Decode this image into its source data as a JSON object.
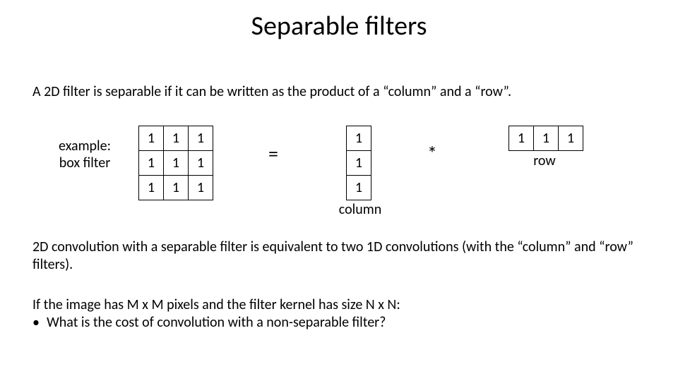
{
  "title": "Separable filters",
  "intro": "A 2D filter is separable if it can be written as the product of a “column” and a “row”.",
  "example_label_line1": "example:",
  "example_label_line2": "box filter",
  "box": {
    "r0c0": "1",
    "r0c1": "1",
    "r0c2": "1",
    "r1c0": "1",
    "r1c1": "1",
    "r1c2": "1",
    "r2c0": "1",
    "r2c1": "1",
    "r2c2": "1"
  },
  "equals": "=",
  "column_vec": {
    "c0": "1",
    "c1": "1",
    "c2": "1"
  },
  "star": "*",
  "row_vec": {
    "r0": "1",
    "r1": "1",
    "r2": "1"
  },
  "row_label": "row",
  "column_label": "column",
  "para2": "2D convolution with a separable filter is equivalent to two 1D convolutions (with the “column” and “row” filters).",
  "para3_line1": "If the image has M x M pixels and the filter kernel has size N x N:",
  "para3_bullet": "•",
  "para3_bullet_text": "What is the cost of convolution with a non-separable filter?"
}
